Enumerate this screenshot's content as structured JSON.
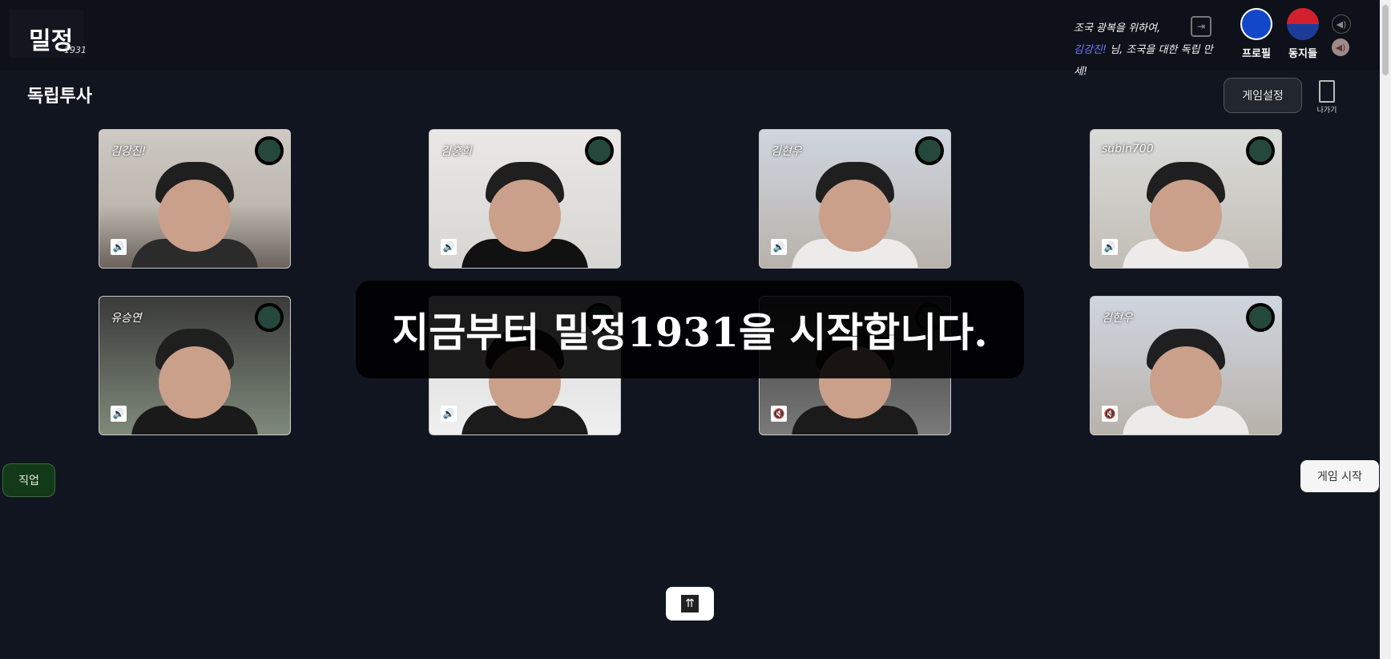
{
  "header": {
    "logo_main": "밀정",
    "logo_sub": "1931",
    "greeting_line1": "조국 광복을 위하여,",
    "greeting_name": "김강진!",
    "greeting_line2_rest": " 님, 조국을 대한 독립 만세!",
    "profile_label": "프로필",
    "comrades_label": "동지들"
  },
  "room": {
    "title": "독립투사",
    "settings_label": "게임설정",
    "exit_label": "나가기"
  },
  "players": [
    {
      "name": "김강진!",
      "muted": false,
      "status_color": "#24493c"
    },
    {
      "name": "김홍희",
      "muted": false,
      "status_color": "#24493c"
    },
    {
      "name": "김현우",
      "muted": false,
      "status_color": "#24493c"
    },
    {
      "name": "subin700",
      "muted": false,
      "status_color": "#24493c"
    },
    {
      "name": "유승연",
      "muted": false,
      "status_color": "#24493c"
    },
    {
      "name": "",
      "muted": false,
      "status_color": "#24493c"
    },
    {
      "name": "",
      "muted": true,
      "status_color": "#24493c"
    },
    {
      "name": "김현우",
      "muted": true,
      "status_color": "#24493c"
    }
  ],
  "announcement": "지금부터 밀정1931을 시작합니다.",
  "buttons": {
    "job": "직업",
    "start_game": "게임 시작"
  },
  "icons": {
    "logout": "logout-icon",
    "profile": "user-icon",
    "comrades": "taegeuk-icon",
    "volume": "speaker-icon",
    "scroll_up": "double-chevron-up-icon"
  },
  "colors": {
    "background": "#111520",
    "header": "#0e1119",
    "job_button": "#123a18",
    "status_dot": "#24493c"
  }
}
